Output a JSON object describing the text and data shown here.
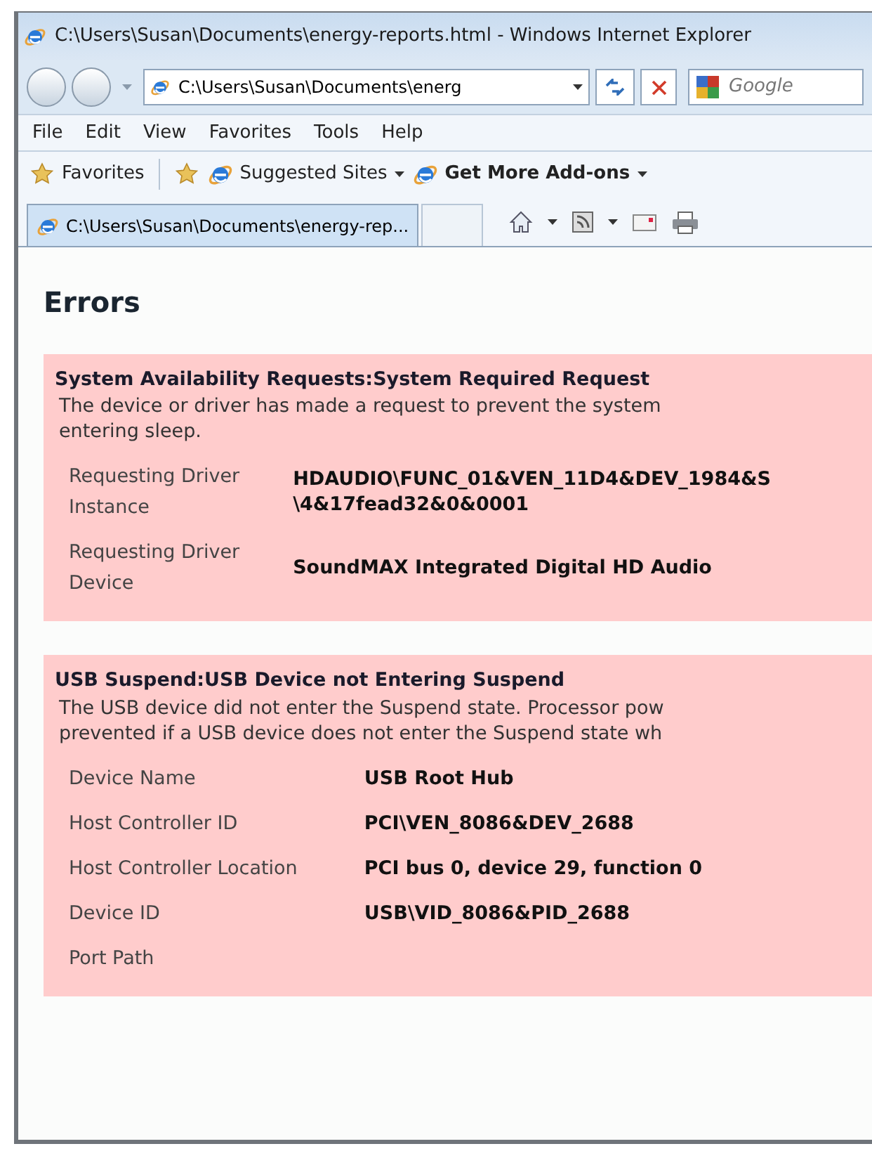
{
  "window": {
    "title": "C:\\Users\\Susan\\Documents\\energy-reports.html - Windows Internet Explorer"
  },
  "address_bar": {
    "value": "C:\\Users\\Susan\\Documents\\energ"
  },
  "search": {
    "placeholder": "Google"
  },
  "menu": [
    "File",
    "Edit",
    "View",
    "Favorites",
    "Tools",
    "Help"
  ],
  "favorites_bar": [
    {
      "label": "Favorites",
      "kind": "favorites",
      "dropdown": false,
      "bold": false
    },
    {
      "label": "Suggested Sites",
      "kind": "site",
      "dropdown": true,
      "bold": false
    },
    {
      "label": "Get More Add-ons",
      "kind": "page",
      "dropdown": true,
      "bold": true
    }
  ],
  "tabs": [
    {
      "label": "C:\\Users\\Susan\\Documents\\energy-rep...",
      "selected": true
    }
  ],
  "page": {
    "heading": "Errors",
    "errors": [
      {
        "title": "System Availability Requests:System Required Request",
        "description": [
          "The device or driver has made a request to prevent the system",
          "entering sleep."
        ],
        "rows": [
          {
            "label": "Requesting Driver Instance",
            "value": [
              "HDAUDIO\\FUNC_01&VEN_11D4&DEV_1984&S",
              "\\4&17fead32&0&0001"
            ]
          },
          {
            "label": "Requesting Driver Device",
            "value": [
              "SoundMAX Integrated Digital HD Audio"
            ]
          }
        ]
      },
      {
        "title": "USB Suspend:USB Device not Entering Suspend",
        "description": [
          "The USB device did not enter the Suspend state. Processor pow",
          "prevented if a USB device does not enter the Suspend state wh"
        ],
        "rows": [
          {
            "label": "Device Name",
            "value": [
              "USB Root Hub"
            ]
          },
          {
            "label": "Host Controller ID",
            "value": [
              "PCI\\VEN_8086&DEV_2688"
            ]
          },
          {
            "label": "Host Controller Location",
            "value": [
              "PCI bus 0, device 29, function 0"
            ]
          },
          {
            "label": "Device ID",
            "value": [
              "USB\\VID_8086&PID_2688"
            ]
          },
          {
            "label": "Port Path",
            "value": []
          }
        ]
      }
    ]
  }
}
